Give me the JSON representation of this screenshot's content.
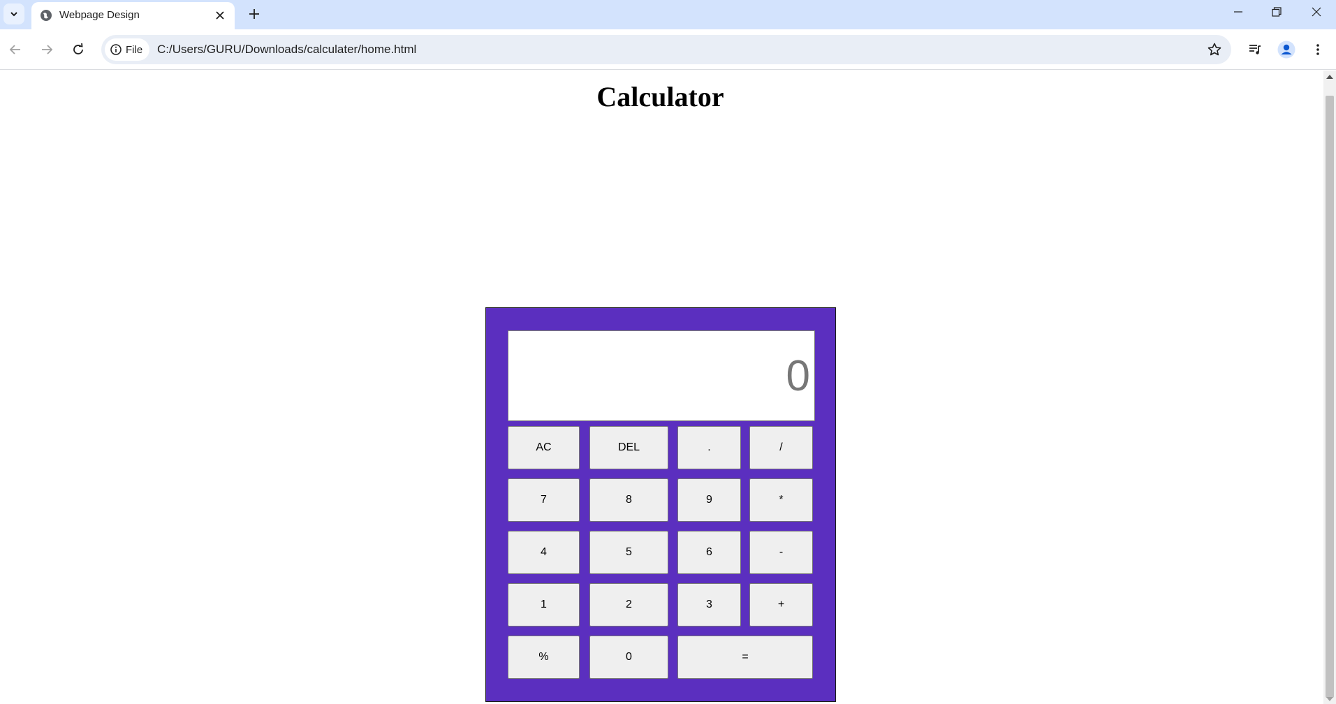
{
  "browser": {
    "tab": {
      "title": "Webpage Design"
    },
    "address": {
      "chip_label": "File",
      "url": "C:/Users/GURU/Downloads/calculater/home.html"
    }
  },
  "page": {
    "title": "Calculator",
    "display_value": "0",
    "keys": {
      "ac": "AC",
      "del": "DEL",
      "dot": ".",
      "divide": "/",
      "seven": "7",
      "eight": "8",
      "nine": "9",
      "multiply": "*",
      "four": "4",
      "five": "5",
      "six": "6",
      "minus": "-",
      "one": "1",
      "two": "2",
      "three": "3",
      "plus": "+",
      "percent": "%",
      "zero": "0",
      "equals": "="
    },
    "colors": {
      "calculator_bg": "#5b2fbf",
      "key_bg": "#efefef",
      "display_text": "#777777"
    }
  }
}
